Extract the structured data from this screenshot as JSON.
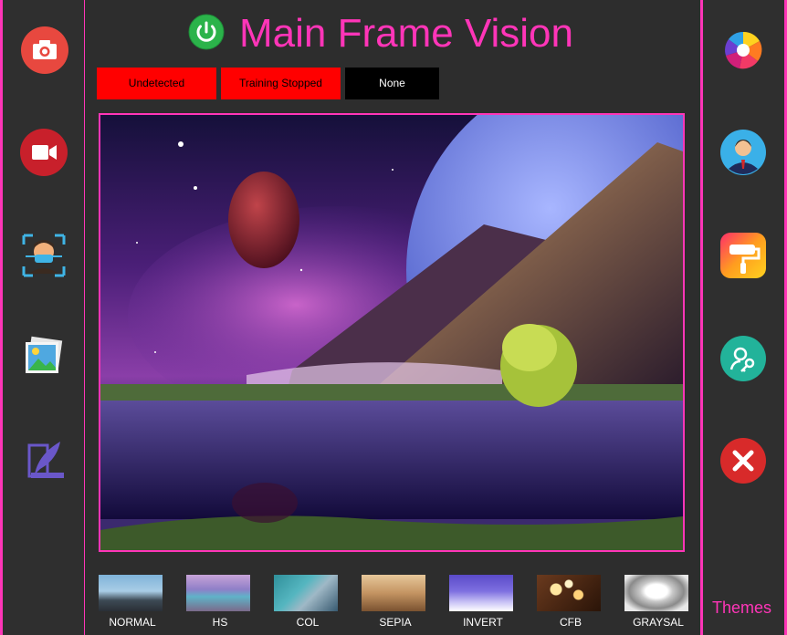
{
  "app": {
    "title": "Main Frame Vision"
  },
  "status": {
    "detection": "Undetected",
    "training": "Training Stopped",
    "selection": "None"
  },
  "filters": [
    {
      "label": "NORMAL"
    },
    {
      "label": "HS"
    },
    {
      "label": "COL"
    },
    {
      "label": "SEPIA"
    },
    {
      "label": "INVERT"
    },
    {
      "label": "CFB"
    },
    {
      "label": "GRAYSAL"
    }
  ],
  "themes_label": "Themes",
  "icons": {
    "left": [
      "camera-icon",
      "video-camera-icon",
      "face-scan-icon",
      "gallery-icon",
      "feather-document-icon"
    ],
    "right": [
      "color-wheel-icon",
      "user-profile-icon",
      "paint-roller-icon",
      "user-key-icon",
      "close-icon"
    ],
    "header": "power-icon"
  },
  "colors": {
    "accent": "#ff35b8",
    "status_alert": "#ff0000",
    "background": "#2d2d2d"
  }
}
